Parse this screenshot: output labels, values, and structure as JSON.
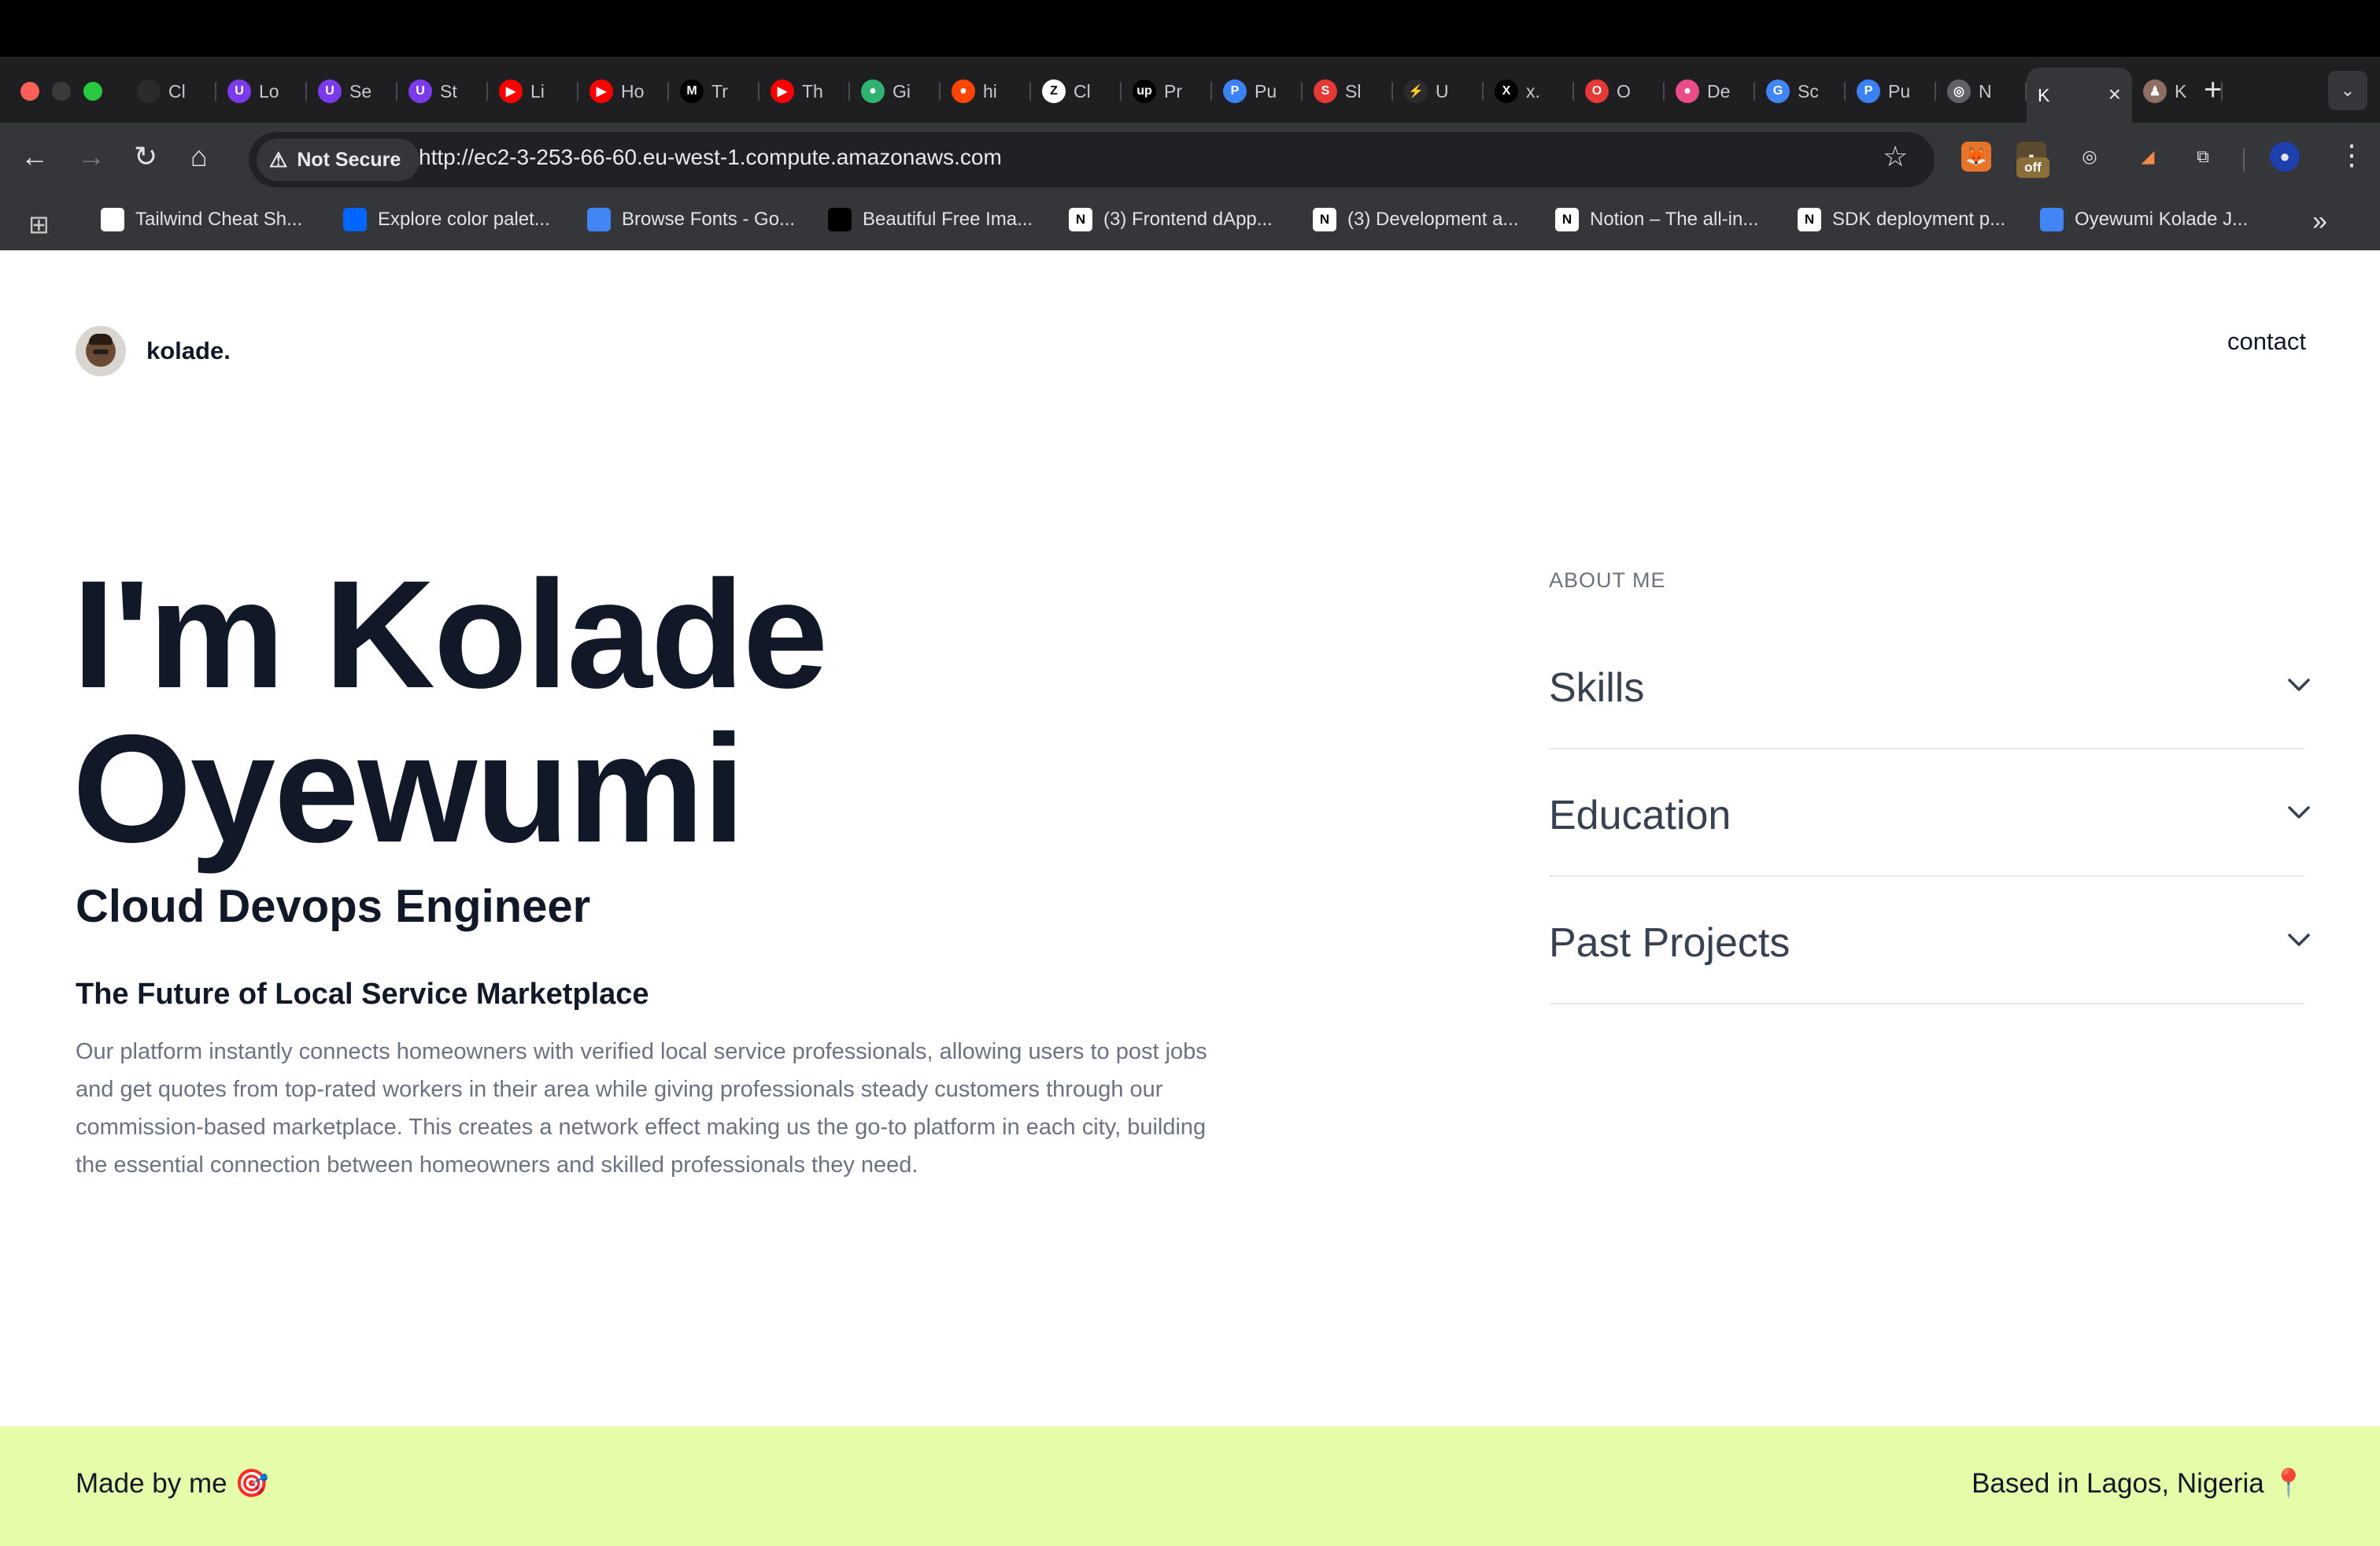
{
  "browser": {
    "tabs": [
      {
        "label": "Cl",
        "icon": "file-icon",
        "color": "#2b2b2e",
        "glyph": ""
      },
      {
        "label": "Lo",
        "icon": "u-logo-icon",
        "color": "#7c3aed",
        "glyph": "U"
      },
      {
        "label": "Se",
        "icon": "u-logo-icon",
        "color": "#7c3aed",
        "glyph": "U"
      },
      {
        "label": "St",
        "icon": "u-logo-icon",
        "color": "#7c3aed",
        "glyph": "U"
      },
      {
        "label": "Li",
        "icon": "youtube-icon",
        "color": "#ff0000",
        "glyph": "▶"
      },
      {
        "label": "Ho",
        "icon": "youtube-icon",
        "color": "#ff0000",
        "glyph": "▶"
      },
      {
        "label": "Tr",
        "icon": "medium-icon",
        "color": "#000000",
        "glyph": "M"
      },
      {
        "label": "Th",
        "icon": "youtube-icon",
        "color": "#ff0000",
        "glyph": "▶"
      },
      {
        "label": "Gi",
        "icon": "chat-icon",
        "color": "#2fb170",
        "glyph": "●"
      },
      {
        "label": "hi",
        "icon": "reddit-icon",
        "color": "#ff4500",
        "glyph": "●"
      },
      {
        "label": "Cl",
        "icon": "zara-icon",
        "color": "#ffffff",
        "glyph": "Z"
      },
      {
        "label": "Pr",
        "icon": "upwork-icon",
        "color": "#000000",
        "glyph": "up"
      },
      {
        "label": "Pu",
        "icon": "pu-icon",
        "color": "#3b82f6",
        "glyph": "P"
      },
      {
        "label": "Sl",
        "icon": "slides-icon",
        "color": "#e53935",
        "glyph": "S"
      },
      {
        "label": "U",
        "icon": "bolt-icon",
        "color": "#2b2b2e",
        "glyph": "⚡"
      },
      {
        "label": "x.",
        "icon": "x-icon",
        "color": "#000000",
        "glyph": "X"
      },
      {
        "label": "O",
        "icon": "opera-icon",
        "color": "#e53935",
        "glyph": "O"
      },
      {
        "label": "De",
        "icon": "dribbble-icon",
        "color": "#ea4c89",
        "glyph": "●"
      },
      {
        "label": "Sc",
        "icon": "fonts-icon",
        "color": "#4285f4",
        "glyph": "G"
      },
      {
        "label": "Pu",
        "icon": "pu-icon",
        "color": "#3b82f6",
        "glyph": "P"
      },
      {
        "label": "N",
        "icon": "chrome-icon",
        "color": "#5f6368",
        "glyph": "◎"
      },
      {
        "label": "K",
        "icon": "page-icon",
        "color": "#35363a",
        "glyph": "",
        "active": true
      },
      {
        "label": "K",
        "icon": "figure-icon",
        "color": "#8d6e63",
        "glyph": "♟"
      }
    ],
    "security_label": "Not Secure",
    "url": "http://ec2-3-253-66-60.eu-west-1.compute.amazonaws.com",
    "extension_badge": "off",
    "bookmarks": [
      {
        "label": "Tailwind Cheat Sh...",
        "icon": "tailwind-icon",
        "color": "#ffffff"
      },
      {
        "label": "Explore color palet...",
        "icon": "coolors-icon",
        "color": "#0066ff"
      },
      {
        "label": "Browse Fonts - Go...",
        "icon": "google-fonts-icon",
        "color": "#4285f4"
      },
      {
        "label": "Beautiful Free Ima...",
        "icon": "unsplash-icon",
        "color": "#000000"
      },
      {
        "label": "(3) Frontend dApp...",
        "icon": "notion-icon",
        "color": "#ffffff"
      },
      {
        "label": "(3) Development a...",
        "icon": "notion-icon",
        "color": "#ffffff"
      },
      {
        "label": "Notion – The all-in...",
        "icon": "notion-icon",
        "color": "#ffffff"
      },
      {
        "label": "SDK deployment p...",
        "icon": "notion-icon",
        "color": "#ffffff"
      },
      {
        "label": "Oyewumi Kolade J...",
        "icon": "google-docs-icon",
        "color": "#4285f4"
      }
    ]
  },
  "site": {
    "brand": "kolade.",
    "nav_contact": "contact",
    "hero_title_line1": "I'm Kolade",
    "hero_title_line2": "Oyewumi",
    "hero_subtitle": "Cloud Devops Engineer",
    "tagline": "The Future of Local Service Marketplace",
    "description": "Our platform instantly connects homeowners with verified local service professionals, allowing users to post jobs and get quotes from top-rated workers in their area while giving professionals steady customers through our commission-based marketplace. This creates a network effect making us the go-to platform in each city, building the essential connection between homeowners and skilled professionals they need.",
    "about_label": "ABOUT ME",
    "accordion": [
      "Skills",
      "Education",
      "Past Projects"
    ],
    "footer_left": "Made by me 🎯",
    "footer_right": "Based in Lagos, Nigeria 📍",
    "footer_color": "#e5fda8"
  }
}
